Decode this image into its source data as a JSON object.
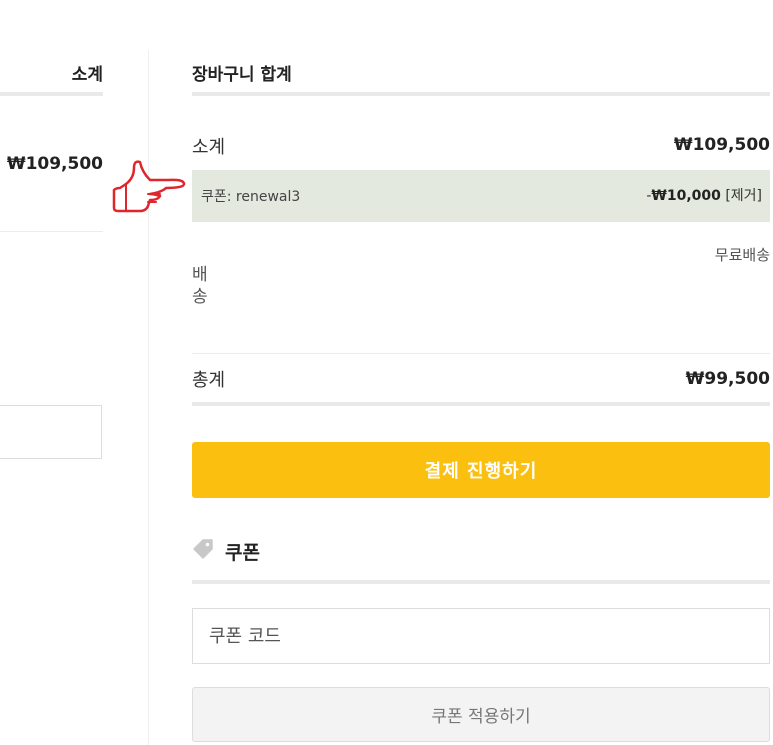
{
  "cart_table": {
    "subtotal_header": "소계",
    "item_subtotal": "₩109,500"
  },
  "cart_totals": {
    "title": "장바구니 합계",
    "subtotal_label": "소계",
    "subtotal_value": "₩109,500",
    "coupon_label": "쿠폰: renewal3",
    "coupon_prefix": "-",
    "coupon_amount": "₩10,000",
    "coupon_remove": "[제거]",
    "shipping_label": "배송",
    "shipping_value": "무료배송",
    "total_label": "총계",
    "total_value": "₩99,500",
    "checkout_button": "결제 진행하기"
  },
  "coupon": {
    "heading": "쿠폰",
    "input_placeholder": "쿠폰 코드",
    "apply_button": "쿠폰 적용하기"
  },
  "icons": {
    "pointer": "pointing-hand-icon",
    "tag": "tag-icon"
  },
  "colors": {
    "checkout_button": "#fbbf10",
    "coupon_row_background": "#e3e9de",
    "pointer_outline": "#e0262d"
  }
}
